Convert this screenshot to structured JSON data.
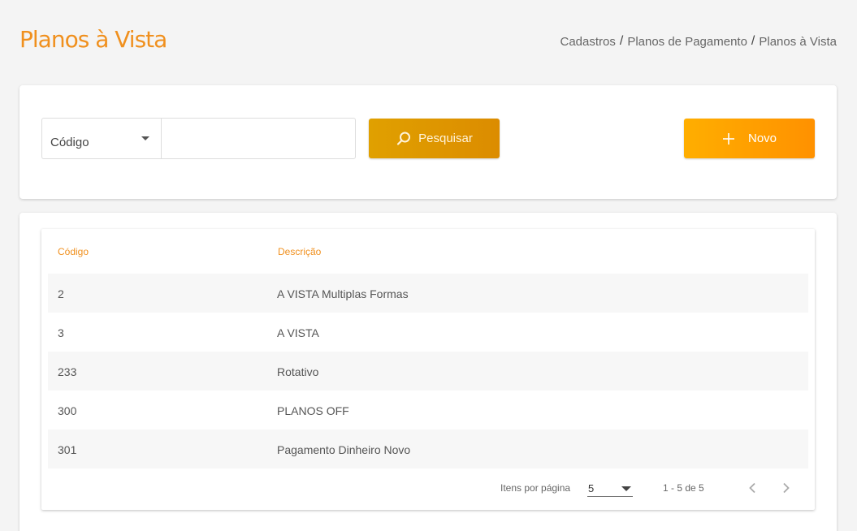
{
  "header": {
    "title": "Planos à Vista",
    "breadcrumb": [
      "Cadastros",
      "Planos de Pagamento",
      "Planos à Vista"
    ],
    "separator": "/"
  },
  "search": {
    "filter_selected": "Código",
    "input_value": "",
    "search_label": "Pesquisar",
    "new_label": "Novo"
  },
  "table": {
    "columns": [
      "Código",
      "Descrição"
    ],
    "rows": [
      {
        "codigo": "2",
        "descricao": "A VISTA Multiplas Formas"
      },
      {
        "codigo": "3",
        "descricao": "A VISTA"
      },
      {
        "codigo": "233",
        "descricao": "Rotativo"
      },
      {
        "codigo": "300",
        "descricao": "PLANOS OFF"
      },
      {
        "codigo": "301",
        "descricao": "Pagamento Dinheiro Novo"
      }
    ]
  },
  "pagination": {
    "items_per_page_label": "Itens por página",
    "items_per_page": "5",
    "range": "1 - 5 de 5"
  },
  "colors": {
    "accent": "#f0901e",
    "search_button": "#dc8c00",
    "new_button": "#ff9100"
  },
  "icons": {
    "search": "search-icon",
    "new": "plus-icon",
    "prev": "chevron-left-icon",
    "next": "chevron-right-icon",
    "dropdown": "caret-down-icon"
  }
}
